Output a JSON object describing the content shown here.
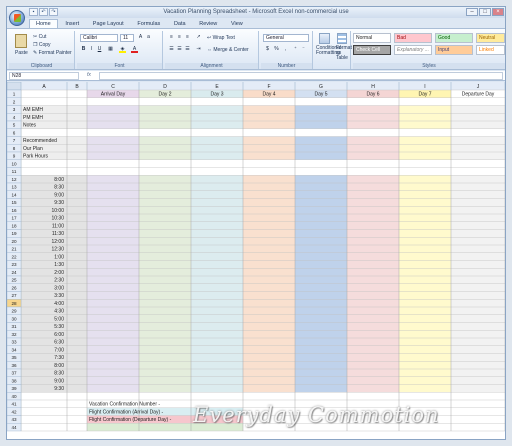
{
  "window": {
    "title": "Vacation Planning Spreadsheet - Microsoft Excel non-commercial use"
  },
  "tabs": [
    "Home",
    "Insert",
    "Page Layout",
    "Formulas",
    "Data",
    "Review",
    "View"
  ],
  "ribbon": {
    "clipboard": {
      "paste": "Paste",
      "cut": "Cut",
      "copy": "Copy",
      "format_painter": "Format Painter",
      "label": "Clipboard"
    },
    "font": {
      "name": "Calibri",
      "size": "11",
      "label": "Font"
    },
    "alignment": {
      "wrap": "Wrap Text",
      "merge": "Merge & Center",
      "label": "Alignment"
    },
    "number": {
      "format": "General",
      "currency": "$",
      "percent": "%",
      "comma": ",",
      "label": "Number"
    },
    "conditional": "Conditional Formatting",
    "format_table": "Format as Table",
    "styles": {
      "label": "Styles",
      "items": [
        "Normal",
        "Bad",
        "Good",
        "Neutral",
        "Check Cell",
        "Explanatory ...",
        "Input",
        "Linked"
      ]
    }
  },
  "formula_bar": {
    "name_box": "N28",
    "fx": "fx",
    "value": ""
  },
  "sheet": {
    "columns": [
      "A",
      "B",
      "C",
      "D",
      "E",
      "F",
      "G",
      "H",
      "I",
      "J"
    ],
    "headers": [
      "Arrival Day",
      "Day 2",
      "Day 3",
      "Day 4",
      "Day 5",
      "Day 6",
      "Day 7",
      "Departure Day"
    ],
    "labels": {
      "3": "AM EMH",
      "4": "PM EMH",
      "5": "Notes",
      "7": "Recommended",
      "8": "Our Plan",
      "9": "Park Hours"
    },
    "times": [
      "8:00",
      "8:30",
      "9:00",
      "9:30",
      "10:00",
      "10:30",
      "11:00",
      "11:30",
      "12:00",
      "12:30",
      "1:00",
      "1:30",
      "2:00",
      "2:30",
      "3:00",
      "3:30",
      "4:00",
      "4:30",
      "5:00",
      "5:30",
      "6:00",
      "6:30",
      "7:00",
      "7:30",
      "8:00",
      "8:30",
      "9:00",
      "9:30"
    ],
    "footer": [
      "Vacation Confirmation Number -",
      "Flight Confirmation (Arrival Day) -",
      "Flight Confirmation (Departure Day) -"
    ],
    "selected_row": 28,
    "colors": {
      "day_header": [
        "#e7d8ea",
        "#e4eddb",
        "#d9ebee",
        "#f9dcc9",
        "#d3e0f1",
        "#f4d5d4",
        "#fff5b2",
        "#ffffff"
      ],
      "day_body": [
        "#e5e0ef",
        "#e4eddc",
        "#dcecef",
        "#f9e0cf",
        "#bfd2eb",
        "#f5dcdc",
        "#fffacd",
        "#f2f2f2"
      ],
      "grid": "#c0c0c0",
      "footer": [
        "#d9eef2",
        "#f6c7cd",
        "#dbecd4"
      ]
    }
  },
  "watermark": "Everyday Commotion"
}
